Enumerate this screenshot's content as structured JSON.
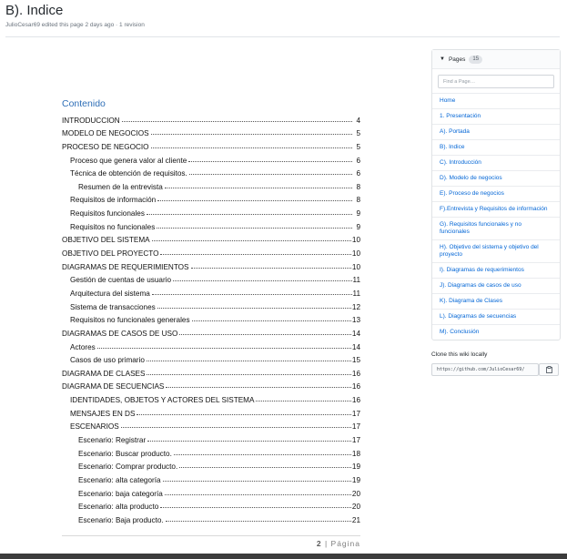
{
  "page": {
    "title": "B). Indice",
    "meta": "JulioCesar69 edited this page 2 days ago · 1 revision"
  },
  "document": {
    "toc_heading": "Contenido",
    "entries": [
      {
        "text": "INTRODUCCION",
        "page": "4",
        "level": 1
      },
      {
        "text": "MODELO DE NEGOCIOS",
        "page": "5",
        "level": 1
      },
      {
        "text": "PROCESO DE NEGOCIO",
        "page": "5",
        "level": 1
      },
      {
        "text": "Proceso que genera valor al cliente",
        "page": "6",
        "level": 2
      },
      {
        "text": "Técnica de obtención de requisitos.",
        "page": "6",
        "level": 2
      },
      {
        "text": "Resumen de la entrevista",
        "page": "8",
        "level": 3
      },
      {
        "text": "Requisitos de información",
        "page": "8",
        "level": 2
      },
      {
        "text": "Requisitos funcionales",
        "page": "9",
        "level": 2
      },
      {
        "text": "Requisitos no funcionales",
        "page": "9",
        "level": 2
      },
      {
        "text": "OBJETIVO DEL SISTEMA",
        "page": "10",
        "level": 1
      },
      {
        "text": "OBJETIVO DEL PROYECTO",
        "page": "10",
        "level": 1
      },
      {
        "text": "DIAGRAMAS DE REQUERIMIENTOS",
        "page": "10",
        "level": 1
      },
      {
        "text": "Gestión de cuentas de usuario",
        "page": "11",
        "level": 2
      },
      {
        "text": "Arquitectura del sistema",
        "page": "11",
        "level": 2
      },
      {
        "text": "Sistema de transacciones",
        "page": "12",
        "level": 2
      },
      {
        "text": "Requisitos no funcionales generales",
        "page": "13",
        "level": 2
      },
      {
        "text": "DIAGRAMAS DE CASOS DE USO",
        "page": "14",
        "level": 1
      },
      {
        "text": "Actores",
        "page": "14",
        "level": 2
      },
      {
        "text": "Casos de uso primario",
        "page": "15",
        "level": 2
      },
      {
        "text": "DIAGRAMA DE CLASES",
        "page": "16",
        "level": 1
      },
      {
        "text": "DIAGRAMA DE SECUENCIAS",
        "page": "16",
        "level": 1
      },
      {
        "text": "IDENTIDADES, OBJETOS Y ACTORES DEL SISTEMA",
        "page": "16",
        "level": 2
      },
      {
        "text": "MENSAJES EN DS",
        "page": "17",
        "level": 2
      },
      {
        "text": "ESCENARIOS",
        "page": "17",
        "level": 2
      },
      {
        "text": "Escenario: Registrar",
        "page": "17",
        "level": 3
      },
      {
        "text": "Escenario: Buscar producto.",
        "page": "18",
        "level": 3
      },
      {
        "text": "Escenario: Comprar producto.",
        "page": "19",
        "level": 3
      },
      {
        "text": "Escenario: alta categoría",
        "page": "19",
        "level": 3
      },
      {
        "text": "Escenario: baja categoría",
        "page": "20",
        "level": 3
      },
      {
        "text": "Escenario: alta producto",
        "page": "20",
        "level": 3
      },
      {
        "text": "Escenario: Baja producto.",
        "page": "21",
        "level": 3
      }
    ],
    "footer_page": "2",
    "footer_label": " | Página"
  },
  "sidebar": {
    "header": "Pages",
    "count": "15",
    "find_placeholder": "Find a Page…",
    "pages": [
      "Home",
      "1. Presentación",
      "A). Portada",
      "B). Indice",
      "C). Introducción",
      "D). Modelo de negocios",
      "E). Proceso de negocios",
      "F).Entrevista y Requisitos de información",
      "G). Requisitos funcionales y no funcionales",
      "H). Objetivo del sistema y objetivo del proyecto",
      "I). Diagramas de requerimientos",
      "J). Diagramas de casos de uso",
      "K). Diagrama de Clases",
      "L). Diagramas de secuencias",
      "M). Conclusión"
    ]
  },
  "clone": {
    "label": "Clone this wiki locally",
    "url": "https://github.com/JulioCesar69/"
  },
  "icons": {
    "caret": "caret-down-icon",
    "clipboard": "clipboard-icon"
  }
}
